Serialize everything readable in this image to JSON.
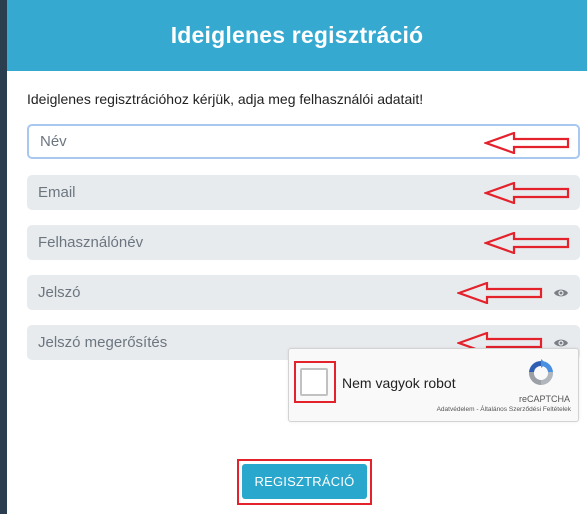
{
  "header": {
    "title": "Ideiglenes regisztráció"
  },
  "intro_text": "Ideiglenes regisztrációhoz kérjük, adja meg felhasználói adatait!",
  "fields": [
    {
      "placeholder": "Név",
      "value": ""
    },
    {
      "placeholder": "Email",
      "value": ""
    },
    {
      "placeholder": "Felhasználónév",
      "value": ""
    },
    {
      "placeholder": "Jelszó",
      "value": ""
    },
    {
      "placeholder": "Jelszó megerősítés",
      "value": ""
    }
  ],
  "captcha": {
    "label": "Nem vagyok robot",
    "brand": "reCAPTCHA",
    "terms": "Adatvédelem - Általános Szerződési Feltételek",
    "checked": false
  },
  "submit": {
    "label": "REGISZTRÁCIÓ"
  },
  "colors": {
    "header": "#36a9d0",
    "button": "#2aa7cc",
    "annotation_red": "#e3222c",
    "field_bg": "#e8ebee"
  },
  "icons": {
    "password_toggle": "eye-icon",
    "annotation": "arrow-left-icon"
  }
}
